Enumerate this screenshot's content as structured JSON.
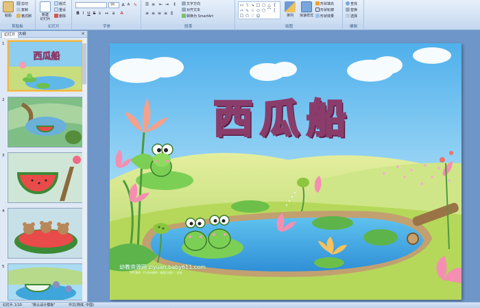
{
  "ribbon": {
    "clipboard": {
      "label": "剪贴板",
      "paste": "粘贴",
      "cut": "剪切",
      "copy": "复制",
      "format_painter": "格式刷"
    },
    "slides": {
      "label": "幻灯片",
      "new_slide": "新建\n幻灯片",
      "layout": "版式",
      "reset": "重设",
      "delete": "删除"
    },
    "font": {
      "label": "字体",
      "font_name": "",
      "font_size": "96"
    },
    "paragraph": {
      "label": "段落",
      "text_direction": "文字方向",
      "align_text": "对齐文本",
      "smartart": "转换为 SmartArt"
    },
    "drawing": {
      "label": "绘图",
      "arrange": "排列",
      "quick_styles": "快速样式",
      "shape_fill": "形状填充",
      "shape_outline": "形状轮廓",
      "shape_effects": "形状效果"
    },
    "editing": {
      "label": "编辑",
      "find": "查找",
      "replace": "替换",
      "select": "选择"
    }
  },
  "panel": {
    "tabs": [
      "幻灯片",
      "大纲"
    ],
    "slide_numbers": [
      "1",
      "2",
      "3",
      "4",
      "5"
    ],
    "thumb1_title": "西瓜船"
  },
  "slide": {
    "title": "西瓜船",
    "watermark": "幼教资源网 ziyuan.baby611.com",
    "watermark_sub": "PPT课件 · FLASH课件 · 教案与图片 · 试卷"
  },
  "status": {
    "slide_pos": "幻灯片 1/10",
    "theme": "\"默认设计模板\"",
    "lang": "中文(简体, 中国)"
  },
  "colors": {
    "ribbon_bg": "#dbe7f6",
    "app_bg": "#6f96c8",
    "selected_thumb": "#f2b544",
    "title_outline": "#8a3d6b"
  }
}
